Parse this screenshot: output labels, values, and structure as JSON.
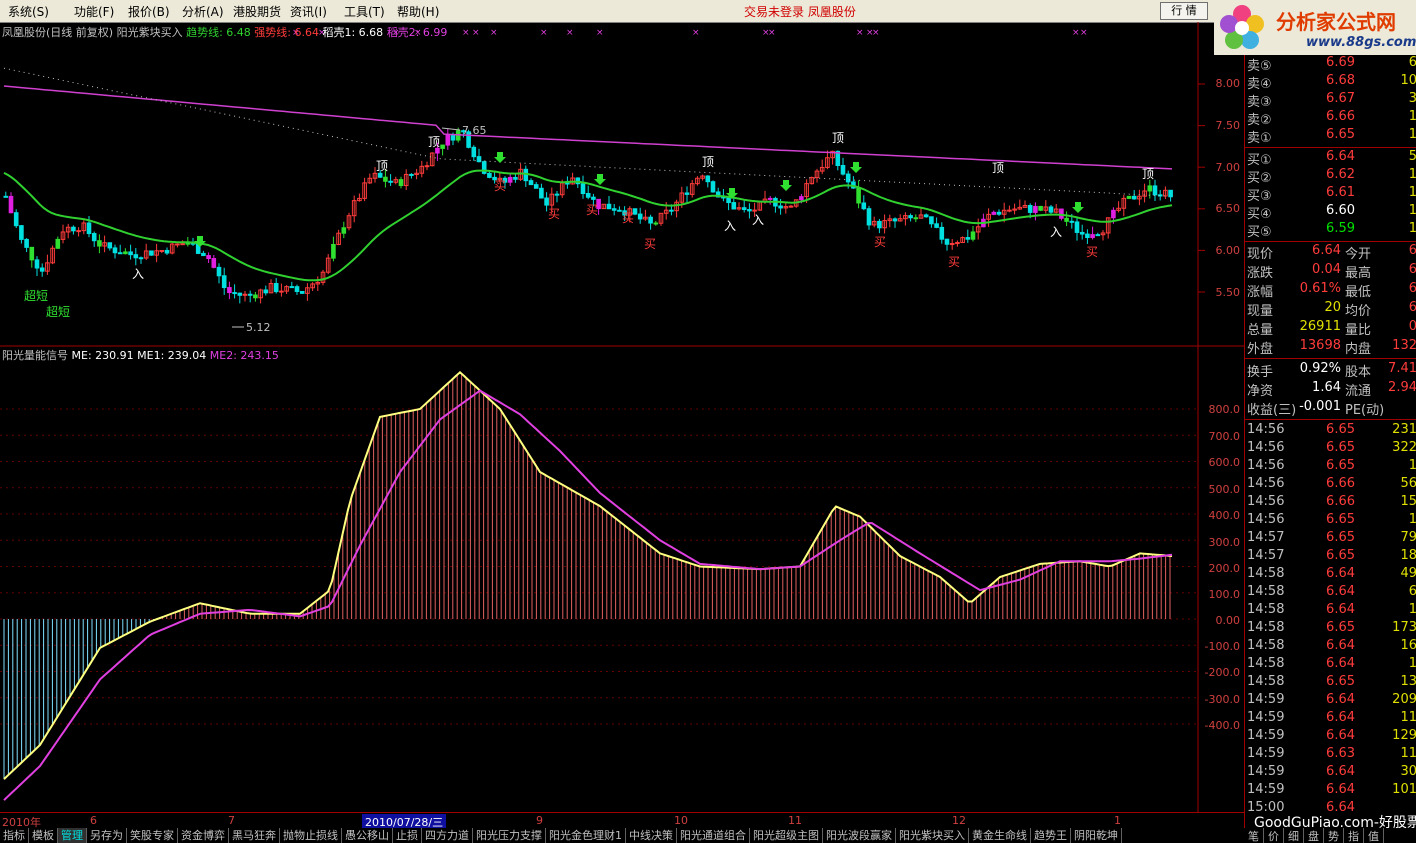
{
  "menu": {
    "items": [
      "系统(S)",
      "功能(F)",
      "报价(B)",
      "分析(A)",
      "港股期货",
      "资讯(I)",
      "工具(T)",
      "帮助(H)"
    ],
    "center_title": "交易未登录  凤凰股份",
    "market_button": "行 情"
  },
  "logo": {
    "brand": "分析家公式网",
    "url": "www.88gs.com"
  },
  "main_info": {
    "stock": "凤凰股份(日线 前复权) 阳光紫块买入",
    "trend_label": "趋势线: 6.48",
    "strong_label": "强势线: 6.64",
    "shell1_label": "稻壳1: 6.68",
    "shell2_label": "稻壳2: 6.99"
  },
  "price_axis": [
    "8.00",
    "7.50",
    "7.00",
    "6.50",
    "6.00",
    "5.50"
  ],
  "chart_labels": {
    "high_mark": "7.65",
    "low_mark": "5.12",
    "top": "顶",
    "buy": "买",
    "enter": "入",
    "super_short": "超短"
  },
  "sub_info": {
    "name": "阳光量能信号",
    "me": "ME: 230.91",
    "me1": "ME1: 239.04",
    "me2": "ME2: 243.15"
  },
  "vol_axis": [
    "800.0",
    "700.0",
    "600.0",
    "500.0",
    "400.0",
    "300.0",
    "200.0",
    "100.0",
    "0.00",
    "-100.0",
    "-200.0",
    "-300.0",
    "-400.0"
  ],
  "date_axis": {
    "year": "2010年",
    "m6": "6",
    "m7": "7",
    "selected": "2010/07/28/三",
    "m9": "9",
    "m10": "10",
    "m11": "11",
    "m12": "12",
    "m1": "1"
  },
  "bottom_tabs": [
    "指标",
    "模板",
    "管理",
    "另存为",
    "笑股专家",
    "资金博弈",
    "黑马狂奔",
    "抛物止损线",
    "愚公移山",
    "止损",
    "四方力道",
    "阳光压力支撑",
    "阳光金色理财1",
    "中线决策",
    "阳光通道组合",
    "阳光超级主图",
    "阳光波段赢家",
    "阳光紫块买入",
    "黄金生命线",
    "趋势王",
    "阴阳乾坤"
  ],
  "orderbook": {
    "asks": [
      {
        "label": "卖⑤",
        "price": "6.69",
        "vol": "6"
      },
      {
        "label": "卖④",
        "price": "6.68",
        "vol": "10"
      },
      {
        "label": "卖③",
        "price": "6.67",
        "vol": "3"
      },
      {
        "label": "卖②",
        "price": "6.66",
        "vol": "1"
      },
      {
        "label": "卖①",
        "price": "6.65",
        "vol": "1"
      }
    ],
    "bids": [
      {
        "label": "买①",
        "price": "6.64",
        "vol": "5"
      },
      {
        "label": "买②",
        "price": "6.62",
        "vol": "1"
      },
      {
        "label": "买③",
        "price": "6.61",
        "vol": "1"
      },
      {
        "label": "买④",
        "price": "6.60",
        "vol": "1"
      },
      {
        "label": "买⑤",
        "price": "6.59",
        "vol": "1"
      }
    ]
  },
  "stats": [
    {
      "l1": "现价",
      "v1": "6.64",
      "l2": "今开",
      "v2": "6"
    },
    {
      "l1": "涨跌",
      "v1": "0.04",
      "l2": "最高",
      "v2": "6"
    },
    {
      "l1": "涨幅",
      "v1": "0.61%",
      "l2": "最低",
      "v2": "6"
    },
    {
      "l1": "现量",
      "v1": "20",
      "l2": "均价",
      "v2": "6"
    },
    {
      "l1": "总量",
      "v1": "26911",
      "l2": "量比",
      "v2": "0"
    },
    {
      "l1": "外盘",
      "v1": "13698",
      "l2": "内盘",
      "v2": "132"
    },
    {
      "l1": "换手",
      "v1": "0.92%",
      "l2": "股本",
      "v2": "7.41"
    },
    {
      "l1": "净资",
      "v1": "1.64",
      "l2": "流通",
      "v2": "2.94"
    },
    {
      "l1": "收益(三)",
      "v1": "-0.001",
      "l2": "PE(动)",
      "v2": ""
    }
  ],
  "ticks": [
    {
      "t": "14:56",
      "p": "6.65",
      "v": "231",
      "c": "red"
    },
    {
      "t": "14:56",
      "p": "6.65",
      "v": "322",
      "c": "red"
    },
    {
      "t": "14:56",
      "p": "6.65",
      "v": "1",
      "c": "red"
    },
    {
      "t": "14:56",
      "p": "6.66",
      "v": "56",
      "c": "red"
    },
    {
      "t": "14:56",
      "p": "6.66",
      "v": "15",
      "c": "red"
    },
    {
      "t": "14:56",
      "p": "6.65",
      "v": "1",
      "c": "red"
    },
    {
      "t": "14:57",
      "p": "6.65",
      "v": "79",
      "c": "red"
    },
    {
      "t": "14:57",
      "p": "6.65",
      "v": "18",
      "c": "red"
    },
    {
      "t": "14:58",
      "p": "6.64",
      "v": "49",
      "c": "red"
    },
    {
      "t": "14:58",
      "p": "6.64",
      "v": "6",
      "c": "red"
    },
    {
      "t": "14:58",
      "p": "6.64",
      "v": "1",
      "c": "red"
    },
    {
      "t": "14:58",
      "p": "6.65",
      "v": "173",
      "c": "red"
    },
    {
      "t": "14:58",
      "p": "6.64",
      "v": "16",
      "c": "red"
    },
    {
      "t": "14:58",
      "p": "6.64",
      "v": "1",
      "c": "red"
    },
    {
      "t": "14:58",
      "p": "6.65",
      "v": "13",
      "c": "red"
    },
    {
      "t": "14:59",
      "p": "6.64",
      "v": "209",
      "c": "red"
    },
    {
      "t": "14:59",
      "p": "6.64",
      "v": "11",
      "c": "red"
    },
    {
      "t": "14:59",
      "p": "6.64",
      "v": "129",
      "c": "red"
    },
    {
      "t": "14:59",
      "p": "6.63",
      "v": "11",
      "c": "red"
    },
    {
      "t": "14:59",
      "p": "6.64",
      "v": "30",
      "c": "red"
    },
    {
      "t": "14:59",
      "p": "6.64",
      "v": "101",
      "c": "red"
    },
    {
      "t": "15:00",
      "p": "6.64",
      "v": "",
      "c": "red"
    }
  ],
  "side_tabs": [
    "笔",
    "价",
    "细",
    "盘",
    "势",
    "指",
    "值"
  ],
  "watermark": "GoodGuPiao.com-好股票网"
}
